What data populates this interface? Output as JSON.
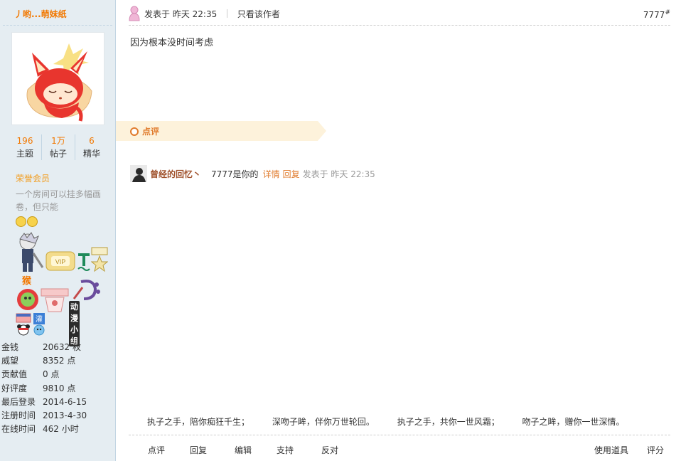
{
  "user": {
    "name": "丿哟...萌妹纸",
    "stats": [
      {
        "value": "196",
        "label": "主题"
      },
      {
        "value": "1万",
        "label": "帖子"
      },
      {
        "value": "6",
        "label": "精华"
      }
    ],
    "group": "荣誉会员",
    "signature": "一个房间可以挂多幅画卷，但只能",
    "medal_label": "猴",
    "anime_medal_label": "动漫小组",
    "info": [
      {
        "key": "金钱",
        "value": "20632 枚"
      },
      {
        "key": "威望",
        "value": "8352 点"
      },
      {
        "key": "贡献值",
        "value": "0 点"
      },
      {
        "key": "好评度",
        "value": "9810 点"
      },
      {
        "key": "最后登录",
        "value": "2014-6-15"
      },
      {
        "key": "注册时间",
        "value": "2013-4-30"
      },
      {
        "key": "在线时间",
        "value": "462 小时"
      }
    ]
  },
  "post": {
    "posted_at": "发表于 昨天 22:35",
    "only_author": "只看该作者",
    "floor": "7777",
    "floor_suffix": "#",
    "content": "因为根本没时间考虑"
  },
  "comments": {
    "title": "点评",
    "items": [
      {
        "author": "曾经的回忆丶",
        "text": "7777是你的",
        "detail_link": "详情",
        "reply_link": "回复",
        "time": "发表于 昨天 22:35"
      }
    ]
  },
  "signature_line": [
    "执子之手，陪你痴狂千生；",
    "深吻子眸，伴你万世轮回。",
    "执子之手，共你一世风霜；",
    "吻子之眸，赠你一世深情。"
  ],
  "actions": {
    "comment": "点评",
    "reply": "回复",
    "edit": "编辑",
    "support": "支持",
    "oppose": "反对",
    "use_item": "使用道具",
    "rate": "评分"
  },
  "colors": {
    "accent_orange": "#f27800",
    "sidebar_bg": "#e5edf2",
    "comment_bar_bg": "#fdf2db"
  },
  "icons": {
    "online": "female-user-icon",
    "comment_marker": "circle-icon"
  }
}
